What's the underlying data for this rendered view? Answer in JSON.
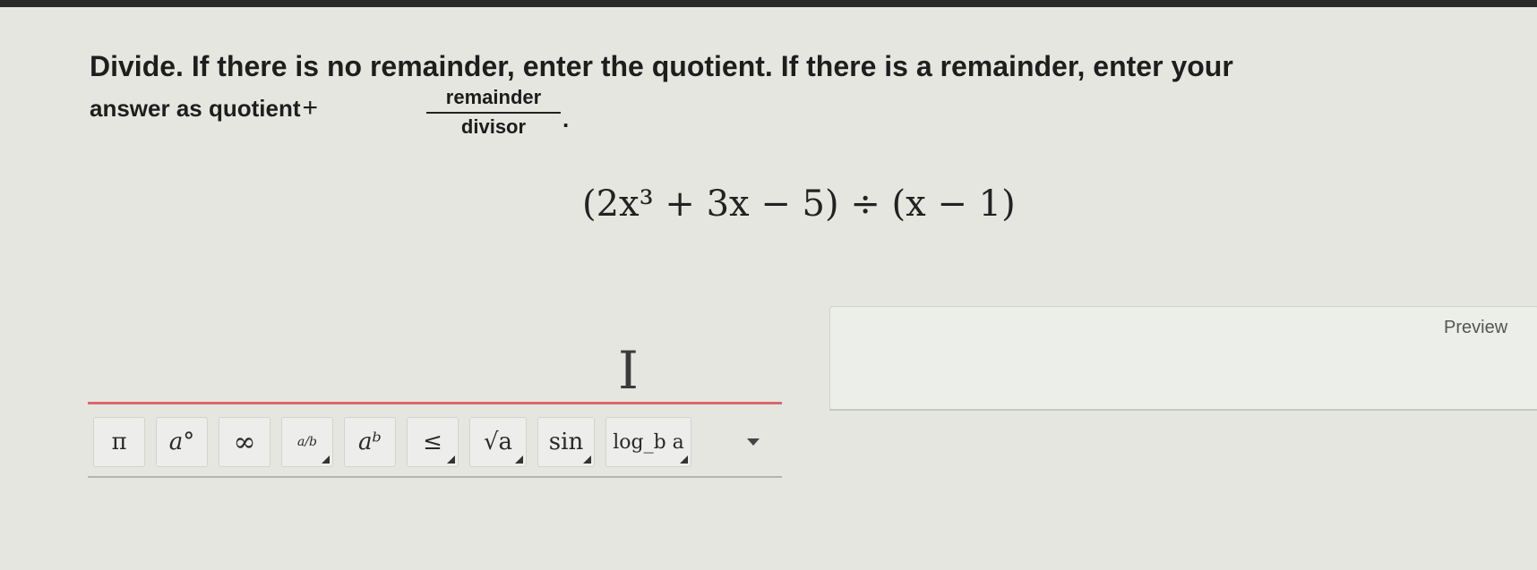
{
  "question": {
    "line1": "Divide. If there is no remainder, enter the quotient. If there is a remainder, enter your",
    "line2_prefix": "answer as quotient",
    "plus": "+",
    "fraction_numerator": "remainder",
    "fraction_denominator": "divisor",
    "period": ".",
    "expression": "(2x³ + 3x − 5) ÷ (x − 1)"
  },
  "answer_input": {
    "cursor_glyph": "I"
  },
  "toolbar": {
    "buttons": [
      {
        "label": "π",
        "has_dropdown": false
      },
      {
        "label": "a°",
        "has_dropdown": false
      },
      {
        "label": "∞",
        "has_dropdown": false
      },
      {
        "label": "a/b",
        "has_dropdown": true
      },
      {
        "label": "aᵇ",
        "has_dropdown": false
      },
      {
        "label": "≤",
        "has_dropdown": true
      },
      {
        "label": "√a",
        "has_dropdown": true
      },
      {
        "label": "sin",
        "has_dropdown": true
      },
      {
        "label": "log_b a",
        "has_dropdown": true
      }
    ]
  },
  "preview": {
    "label": "Preview"
  },
  "colors": {
    "background": "#e6e6e1",
    "answer_underline": "#d96a6a",
    "button_bg": "#ededeb"
  }
}
